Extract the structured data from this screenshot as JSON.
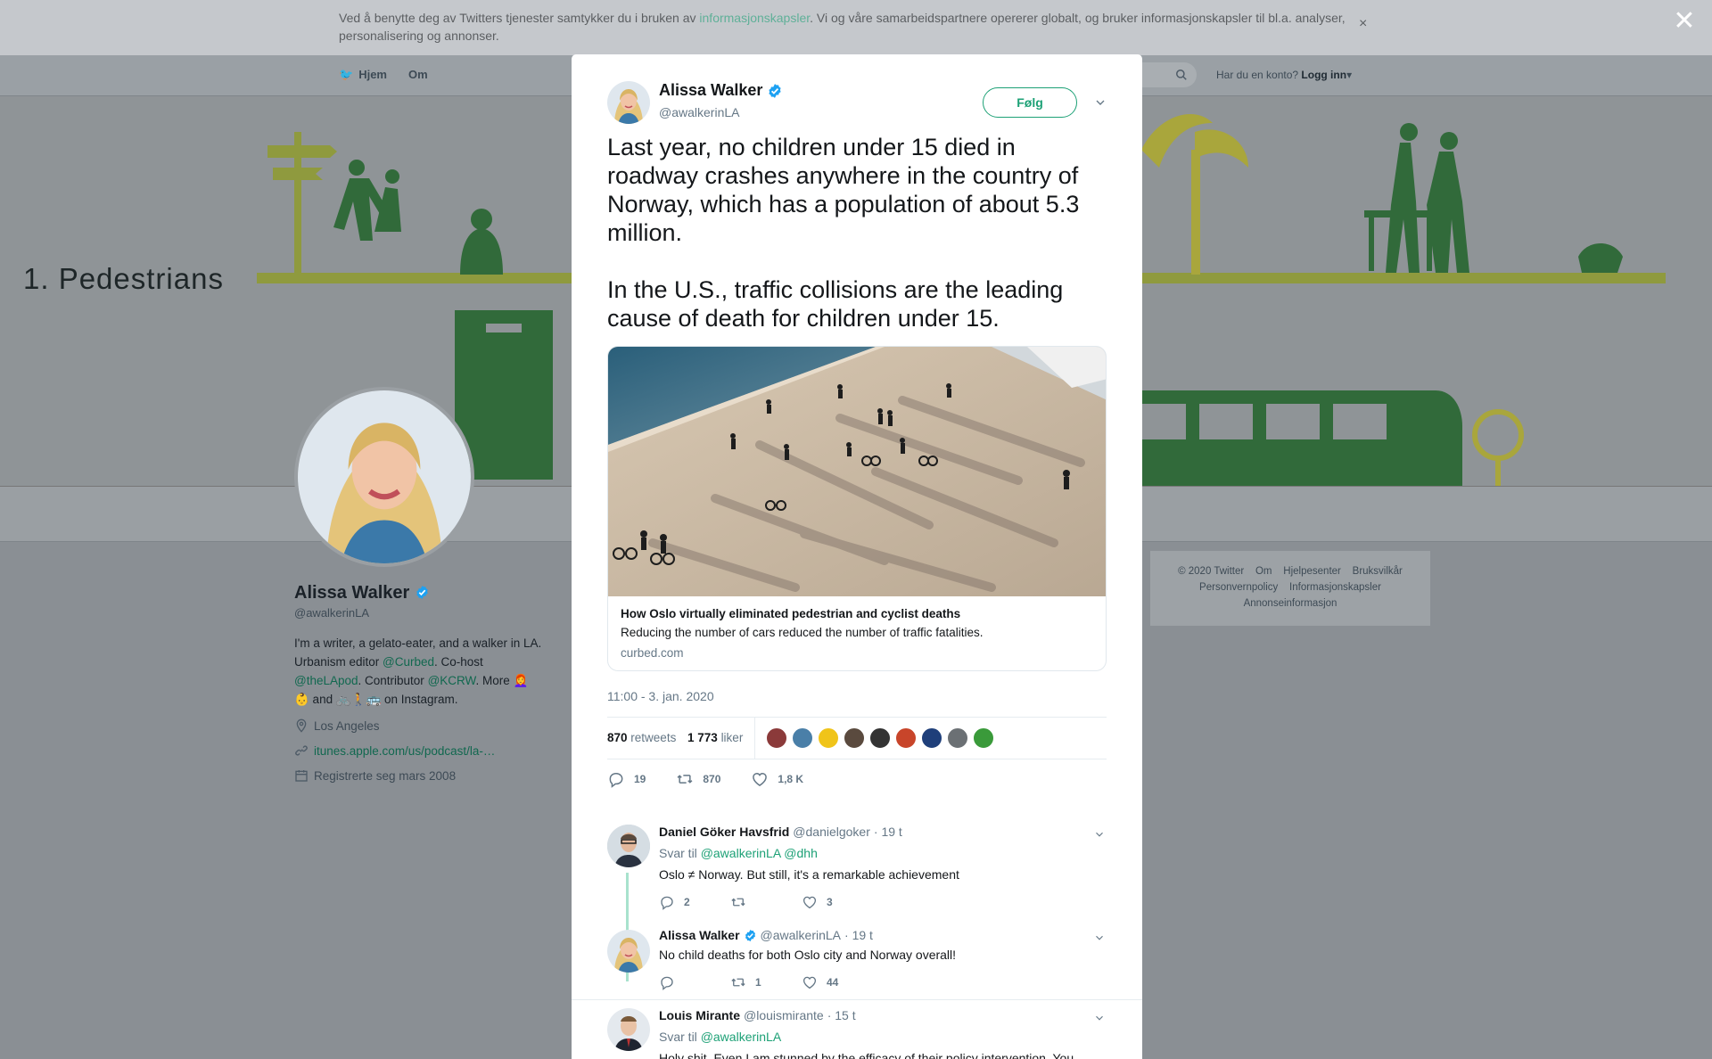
{
  "cookie": {
    "text_before": "Ved å benytte deg av Twitters tjenester samtykker du i bruken av ",
    "link": "informasjonskapsler",
    "text_after": ". Vi og våre samarbeidspartnere opererer globalt, og bruker informasjonskapsler til bl.a. analyser, personalisering og annonser.",
    "close": "×"
  },
  "overlay_close": "✕",
  "background": {
    "nav": {
      "home": "Hjem",
      "about": "Om"
    },
    "login_prompt": "Har du en konto?",
    "login_link": "Logg inn",
    "banner_label": "1. Pedestrians",
    "profile": {
      "name": "Alissa Walker",
      "handle": "@awalkerinLA",
      "bio_1": "I'm a writer, a gelato-eater, and a walker in LA. Urbanism editor ",
      "bio_link1": "@Curbed",
      "bio_2": ". Co-host ",
      "bio_link2": "@theLApod",
      "bio_3": ". Contributor ",
      "bio_link3": "@KCRW",
      "bio_4": ". More 👩‍🦰",
      "bio_5": "👶 and 🚲🚶🚌 on Instagram.",
      "location": "Los Angeles",
      "url": "itunes.apple.com/us/podcast/la-…",
      "joined": "Registrerte seg mars 2008"
    },
    "footer": {
      "copyright": "© 2020 Twitter",
      "about": "Om",
      "help": "Hjelpesenter",
      "terms": "Bruksvilkår",
      "privacy": "Personvernpolicy",
      "cookies": "Informasjonskapsler",
      "ads": "Annonseinformasjon"
    }
  },
  "tweet": {
    "name": "Alissa Walker",
    "handle": "@awalkerinLA",
    "follow_label": "Følg",
    "paragraph_1": "Last year, no children under 15 died in roadway crashes anywhere in the country of Norway, which has a population of about 5.3 million.",
    "paragraph_2": "In the U.S., traffic collisions are the leading cause of death for children under 15.",
    "card": {
      "title": "How Oslo virtually eliminated pedestrian and cyclist deaths",
      "description": "Reducing the number of cars reduced the number of traffic fatalities.",
      "domain": "curbed.com"
    },
    "timestamp": "11:00 - 3. jan. 2020",
    "retweets_count": "870",
    "retweets_label": "retweets",
    "likes_count": "1 773",
    "likes_label": "liker",
    "actions": {
      "replies": "19",
      "retweets": "870",
      "likes": "1,8 K"
    }
  },
  "replies": [
    {
      "name": "Daniel Göker Havsfrid",
      "handle": "@danielgoker",
      "time": "· 19 t",
      "reply_to_label": "Svar til",
      "reply_to": "@awalkerinLA @dhh",
      "text": "Oslo ≠ Norway. But still, it's a remarkable achievement",
      "replies": "2",
      "retweets": "",
      "likes": "3"
    },
    {
      "name": "Alissa Walker",
      "handle": "@awalkerinLA",
      "time": "· 19 t",
      "text": "No child deaths for both Oslo city and Norway overall!",
      "replies": "",
      "retweets": "1",
      "likes": "44"
    },
    {
      "name": "Louis Mirante",
      "handle": "@louismirante",
      "time": "· 15 t",
      "reply_to_label": "Svar til",
      "reply_to": "@awalkerinLA",
      "text": "Holy shit. Even I am stunned by the efficacy of their policy intervention. You"
    }
  ],
  "colors": {
    "accent": "#1da176",
    "verified": "#1da1f2",
    "text": "#14171a",
    "muted": "#657786"
  }
}
